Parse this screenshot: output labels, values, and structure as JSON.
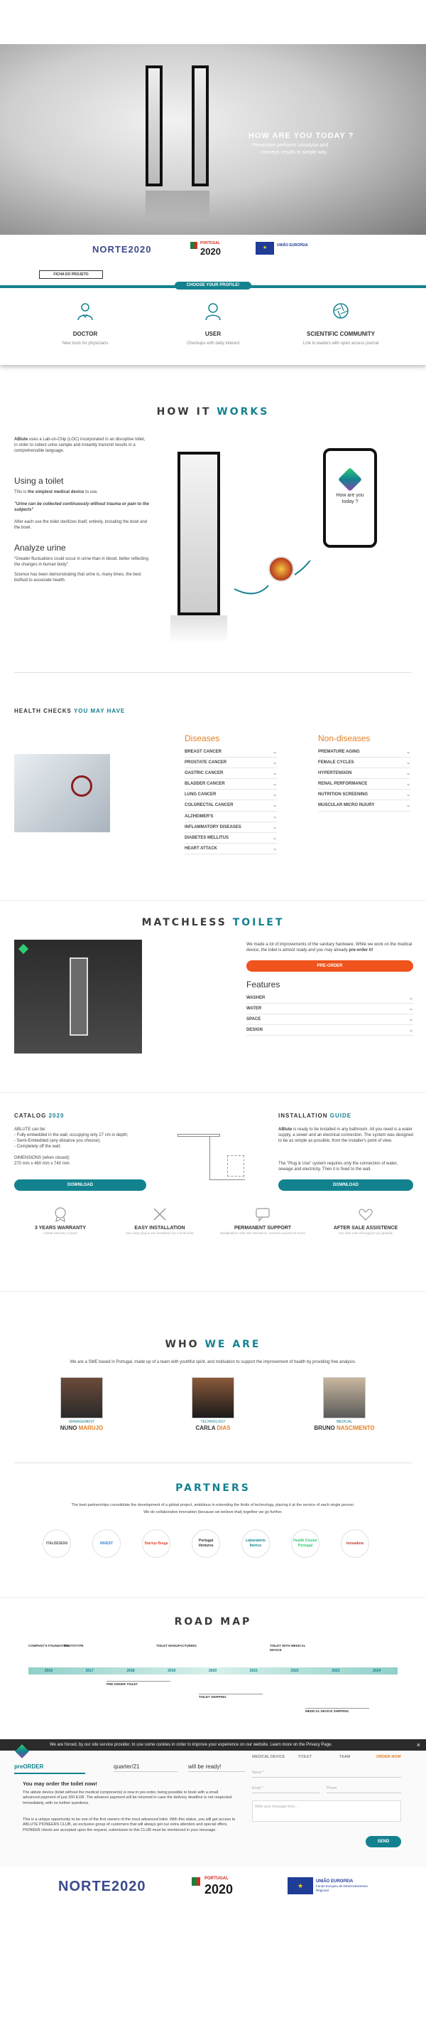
{
  "hero": {
    "title": "HOW ARE YOU TODAY ?",
    "line1": "Preventive performs urinalysis and",
    "line2": "conveys results in simple way"
  },
  "funding": {
    "norte_logo": "NORTE2020",
    "portugal_logo": "2020",
    "portugal_label": "PORTUGAL",
    "eu_label": "UNIÃO EUROPEIA",
    "project_button": "FICHA DO PROJETO"
  },
  "profile": {
    "label": "CHOOSE YOUR PROFILE!",
    "cards": [
      {
        "title": "DOCTOR",
        "desc": "New tools for physicians",
        "icon": "doctor-icon"
      },
      {
        "title": "USER",
        "desc": "Checkups with daily interest",
        "icon": "user-icon"
      },
      {
        "title": "SCIENTIFIC COMMUNITY",
        "desc": "Link to leaders with open access journal",
        "icon": "aperture-icon"
      }
    ]
  },
  "how_it_works": {
    "title_a": "HOW IT",
    "title_b": "WORKS",
    "intro_brand": "ABlute",
    "intro": "uses a Lab-on-Chip (LOC) incorporated in an disruptive toilet, in order to collect urine sample and instantly transmit results in a comprehensible language.",
    "toilet_heading": "Using a toilet",
    "toilet_p1a": "This is",
    "toilet_p1b": "the simplest medical device",
    "toilet_p1c": "to use.",
    "toilet_quote": "\"Urine can be collected continuously without trauma or pain to the subjects\"",
    "toilet_p2": "After each use the toilet sterilizes itself, entirely, including the bowl and the bowl.",
    "urine_heading": "Analyze urine",
    "urine_p1": "\"Greater fluctuations could occur in urine than in blood, better reflecting the changes in human body\"",
    "urine_p2": "Science has been demonstrating that urine is, many times, the best biofluid to associate health.",
    "phone_text": "How are you today ?"
  },
  "health_checks": {
    "title_a": "HEALTH CHECKS",
    "title_b": "YOU MAY HAVE",
    "diseases_title": "Diseases",
    "diseases": [
      "BREAST CANCER",
      "PROSTATE CANCER",
      "GASTRIC CANCER",
      "BLADDER CANCER",
      "LUNG CANCER",
      "COLORECTAL CANCER",
      "ALZHEIMER'S",
      "INFLAMMATORY DISEASES",
      "DIABETES MELLITUS",
      "HEART ATTACK"
    ],
    "non_title": "Non-diseases",
    "non_diseases": [
      "PREMATURE AGING",
      "FEMALE CYCLES",
      "HYPERTENSION",
      "RENAL PERFORMANCE",
      "NUTRITION SCREENING",
      "MUSCULAR MICRO INJURY"
    ]
  },
  "matchless": {
    "title_a": "MATCHLESS",
    "title_b": "TOILET",
    "desc": "We made a lot of improvements of the sanitary hardware. While we work on the medical device, the toilet is almost ready and you may already",
    "desc_bold": "pre-order it!",
    "preorder": "PRE-ORDER",
    "features_title": "Features",
    "features": [
      "WASHER",
      "WATER",
      "SPACE",
      "DESIGN"
    ]
  },
  "catalog": {
    "title_a": "CATALOG",
    "title_b": "2020",
    "lines": [
      "ABLUTE can be:",
      "- Fully embedded in the wall, occupying only 27 cm in depth;",
      "- Semi-Embedded (any distance you choose);",
      "- Completely off the wall;"
    ],
    "dims_label": "DIMENSIONS (when closed):",
    "dims": "270 mm x 460 mm x 740 mm",
    "download": "DOWNLOAD"
  },
  "install": {
    "title_a": "INSTALLATION",
    "title_b": "GUIDE",
    "p1_brand": "ABlute",
    "p1": "is ready to be installed in any bathroom. All you need is a water supply, a sewer and an electrical connection. The system was designed to be as simple as possible, from the installer's point of view.",
    "p2": "The \"Plug & Use\" system requires only the connection of water, sewage and electricity. Then it is fixed to the wall.",
    "download": "DOWNLOAD"
  },
  "benefits": [
    {
      "title": "3 YEARS WARRANTY",
      "desc": "Global warranty 3 years",
      "icon": "badge-icon"
    },
    {
      "title": "EASY INSTALLATION",
      "desc": "Very easy plug & use installation by a technician",
      "icon": "tools-icon"
    },
    {
      "title": "PERMANENT SUPPORT",
      "desc": "Multiplatform with 24h assistance, answers around 24 hours",
      "icon": "chat-icon"
    },
    {
      "title": "AFTER SALE ASSISTENCE",
      "desc": "Our after sale will support you globally",
      "icon": "heart-icon"
    }
  ],
  "who": {
    "title_a": "WHO",
    "title_b": "WE ARE",
    "desc": "We are a SME based in Portugal, made up of a team with youthful spirit, and motivation to support the improvement of health by providing free analysis.",
    "team": [
      {
        "role": "MANAGEMENT",
        "first": "NUNO",
        "last": "MARUJO"
      },
      {
        "role": "TECHNOLOGY",
        "first": "CARLA",
        "last": "DIAS"
      },
      {
        "role": "MEDICAL",
        "first": "BRUNO",
        "last": "NASCIMENTO"
      }
    ]
  },
  "partners": {
    "title": "PARTNERS",
    "line1": "The best partnerships consolidate the development of a global project, ambitious in extending the limits of technology, placing it at the service of each single person.",
    "line2": "We do collaborative innovation (because we believe that) together we go further.",
    "logos": [
      "ITALDESIGN",
      "INVEST",
      "Startup Braga",
      "Portugal Ventures",
      "Laboratório Ibérico",
      "Health Cluster Portugal",
      "Inovadora"
    ]
  },
  "roadmap": {
    "title": "ROAD MAP",
    "years": [
      "2016",
      "2017",
      "2018",
      "2019",
      "2020",
      "2021",
      "2022",
      "2023",
      "2024"
    ],
    "milestones_top": [
      "COMPANY'S FOUNDATION",
      "PROTOTYPE",
      "TOILET MANUFACTURING",
      "TOILET WITH MEDICAL DEVICE"
    ],
    "milestones_bottom": [
      "PRE-ORDER TOILET",
      "TOILET SHIPPING",
      "MEDICAL DEVICE SHIPPING"
    ]
  },
  "cookie": {
    "text": "We are forced, by our site service provider, to use some cookies in order to improve your experience on our website. Learn more on the Privacy Page.",
    "close": "×"
  },
  "preorder": {
    "tab1": "preORDER",
    "tab2": "quarter/21",
    "tab3": "will be ready!",
    "nav": [
      "MEDICAL DEVICE",
      "TOILET",
      "TEAM"
    ],
    "nav_cta": "ORDER NOW",
    "heading": "You may order the toilet now!",
    "p1": "The ablute device (toilet without the medical components) is now in pre-order, being possible to book with a small advanced payment of just 200 EUR. The advance payment will be returned in case the delivery deadline is not respected. Immediately, with no further questions.",
    "p2": "This is a unique opportunity to be one of the first owners of the most advanced toilet. With this status, you will get access to ABLUTE PIONEERS CLUB, an exclusive group of customers that will always get our extra attention and special offers. PIONEER clients are accepted upon the request, submission to this CLUB must be mentioned in your message.",
    "name_ph": "Name *",
    "email_ph": "Email *",
    "phone_ph": "Phone",
    "msg_ph": "Write your message here...",
    "send": "SEND"
  },
  "footer": {
    "norte_logo": "NORTE2020",
    "portugal_label": "PORTUGAL",
    "portugal_logo": "2020",
    "eu_label": "UNIÃO EUROPEIA",
    "eu_sub": "Fundo Europeu de Desenvolvimento Regional"
  }
}
